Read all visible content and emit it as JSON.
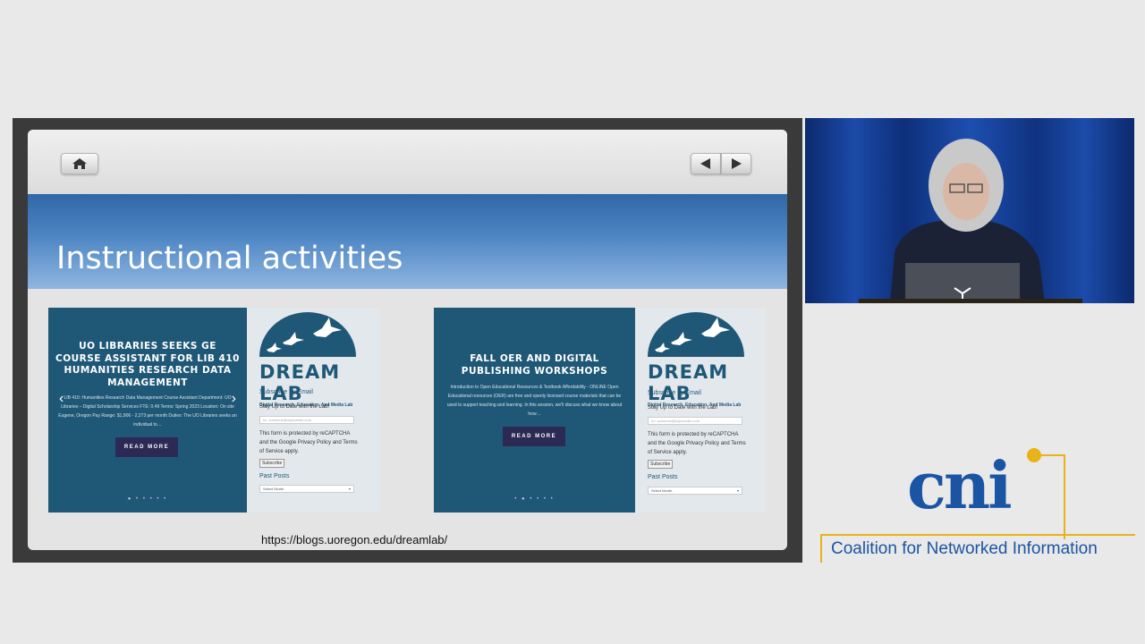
{
  "slide": {
    "title": "Instructional activities",
    "url": "https://blogs.uoregon.edu/dreamlab/",
    "cards": [
      {
        "headline": "UO LIBRARIES SEEKS GE COURSE ASSISTANT FOR LIB 410 HUMANITIES RESEARCH DATA MANAGEMENT",
        "excerpt": "LIB 410: Humanities Research Data Management Course Assistant Department: UO Libraries – Digital Scholarship Services FTE: 0.49 Terms: Spring 2023 Location: On site Eugene, Oregon Pay Range: $1,906 - 2,273 per month Duties: The UO Libraries seeks an individual to…",
        "read_more": "READ MORE",
        "prev_arrow": "‹",
        "next_arrow": "›",
        "pager": "● • • • • •"
      },
      {
        "headline": "FALL OER AND DIGITAL PUBLISHING WORKSHOPS",
        "excerpt": "Introduction to Open Educational Resources & Textbook Affordability - ONLINE Open Educational resources (OER) are free and openly licensed course materials that can be used to support teaching and learning. In this session, we'll discuss what we know about how…",
        "read_more": "READ MORE",
        "pager": "• ● • • • •"
      }
    ],
    "sidebar": {
      "logo_word": "DREAM LAB",
      "logo_tagline": "Digital Research, Education, And Media Lab",
      "subscribe_heading": "Subscribe by Email",
      "subscribe_text": "Stay Up to Date with the Lab!",
      "email_placeholder": "ex: someone@mydomain.com",
      "recaptcha_text": "This form is protected by reCAPTCHA and the Google Privacy Policy and Terms of Service apply.",
      "subscribe_button": "Subscribe",
      "past_posts_heading": "Past Posts",
      "select_month": "Select Month"
    }
  },
  "branding": {
    "cni_word": "cni",
    "cni_caption": "Coalition for Networked Information"
  },
  "colors": {
    "card_blue": "#1f5877",
    "cni_blue": "#1a55a4",
    "cni_gold": "#e9b218"
  }
}
